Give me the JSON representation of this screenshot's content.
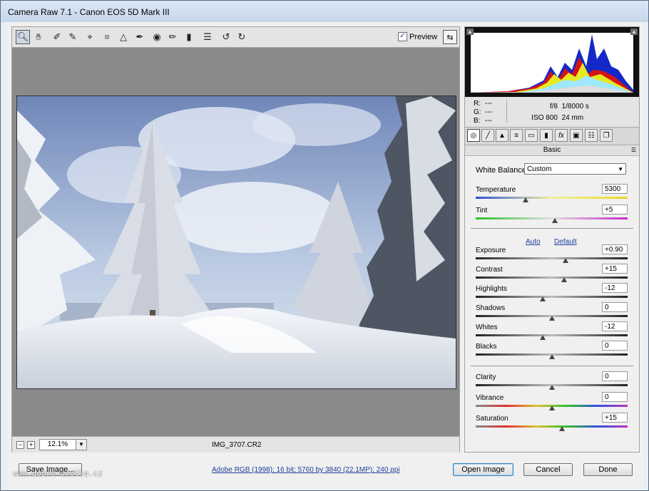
{
  "window": {
    "title": "Camera Raw 7.1  -  Canon EOS 5D Mark III"
  },
  "toolbar": {
    "tools": [
      "zoom-icon",
      "hand-icon",
      "white-balance-icon",
      "color-sampler-icon",
      "target-adjust-icon",
      "crop-icon",
      "straighten-icon",
      "spot-removal-icon",
      "red-eye-icon",
      "adjustment-brush-icon",
      "graduated-filter-icon",
      "preferences-icon",
      "rotate-ccw-icon",
      "rotate-cw-icon"
    ],
    "preview_label": "Preview",
    "preview_checked": true
  },
  "statusbar": {
    "zoom": "12.1%",
    "filename": "IMG_3707.CR2"
  },
  "readout": {
    "r_label": "R:",
    "r_value": "---",
    "g_label": "G:",
    "g_value": "---",
    "b_label": "B:",
    "b_value": "---",
    "aperture": "f/8",
    "shutter": "1/8000 s",
    "iso": "ISO 800",
    "focal": "24 mm"
  },
  "panel": {
    "title": "Basic",
    "white_balance_label": "White Balance:",
    "white_balance_value": "Custom",
    "auto_label": "Auto",
    "default_label": "Default",
    "sliders": [
      {
        "id": "temperature",
        "label": "Temperature",
        "value": "5300",
        "pos": 0.33
      },
      {
        "id": "tint",
        "label": "Tint",
        "value": "+5",
        "pos": 0.52
      },
      {
        "id": "exposure",
        "label": "Exposure",
        "value": "+0.90",
        "pos": 0.59
      },
      {
        "id": "contrast",
        "label": "Contrast",
        "value": "+15",
        "pos": 0.58
      },
      {
        "id": "highlights",
        "label": "Highlights",
        "value": "-12",
        "pos": 0.44
      },
      {
        "id": "shadows",
        "label": "Shadows",
        "value": "0",
        "pos": 0.5
      },
      {
        "id": "whites",
        "label": "Whites",
        "value": "-12",
        "pos": 0.44
      },
      {
        "id": "blacks",
        "label": "Blacks",
        "value": "0",
        "pos": 0.5
      },
      {
        "id": "clarity",
        "label": "Clarity",
        "value": "0",
        "pos": 0.5
      },
      {
        "id": "vibrance",
        "label": "Vibrance",
        "value": "0",
        "pos": 0.5
      },
      {
        "id": "saturation",
        "label": "Saturation",
        "value": "+15",
        "pos": 0.57
      }
    ]
  },
  "footer": {
    "save_label": "Save Image...",
    "workflow_link": "Adobe RGB (1998); 16 bit; 5760 by 3840 (22.1MP); 240 ppi",
    "open_label": "Open Image",
    "cancel_label": "Cancel",
    "done_label": "Done",
    "watermark": "www.dobre-svetlo.cz"
  },
  "colors": {
    "accent_link": "#1a3f9a",
    "primary_border": "#3c7fb1"
  }
}
